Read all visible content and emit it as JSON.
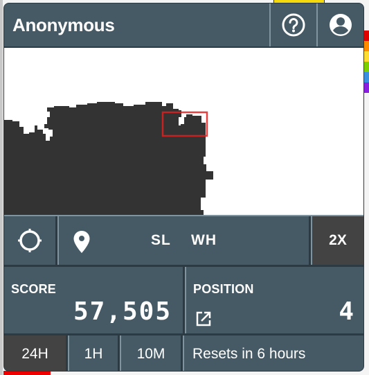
{
  "header": {
    "title": "Anonymous",
    "help_icon": "question-circle-icon",
    "user_icon": "account-circle-icon"
  },
  "map": {
    "selection_color": "#e02020",
    "land_color": "#333333"
  },
  "controls": {
    "locate_icon": "crosshair-icon",
    "pin_icon": "map-pin-icon",
    "coordinates": "SL  WH",
    "zoom_label": "2X"
  },
  "stats": {
    "score_label": "SCORE",
    "score_value": "57,505",
    "position_label": "POSITION",
    "position_value": "4",
    "external_link_icon": "open-in-new-icon"
  },
  "ranges": {
    "options": [
      "24H",
      "1H",
      "10M"
    ],
    "selected": "24H",
    "reset_text": "Resets in 6 hours"
  },
  "background": {
    "palette_colors": [
      "#e00000",
      "#ff8a00",
      "#ffdd33",
      "#7ccf00",
      "#3a8fe0",
      "#8a1ee0"
    ]
  }
}
